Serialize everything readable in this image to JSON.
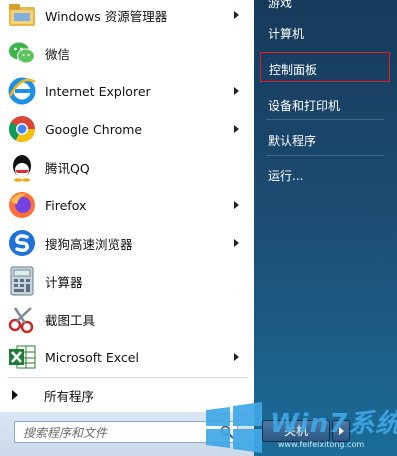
{
  "start_menu": {
    "programs": [
      {
        "label": "Windows 资源管理器",
        "icon": "folder-icon",
        "has_submenu": true
      },
      {
        "label": "微信",
        "icon": "wechat-icon",
        "has_submenu": false
      },
      {
        "label": "Internet Explorer",
        "icon": "internet-explorer-icon",
        "has_submenu": true
      },
      {
        "label": "Google Chrome",
        "icon": "chrome-icon",
        "has_submenu": true
      },
      {
        "label": "腾讯QQ",
        "icon": "qq-icon",
        "has_submenu": false
      },
      {
        "label": "Firefox",
        "icon": "firefox-icon",
        "has_submenu": true
      },
      {
        "label": "搜狗高速浏览器",
        "icon": "sogou-icon",
        "has_submenu": true
      },
      {
        "label": "计算器",
        "icon": "calculator-icon",
        "has_submenu": false
      },
      {
        "label": "截图工具",
        "icon": "snipping-tool-icon",
        "has_submenu": false
      },
      {
        "label": "Microsoft Excel",
        "icon": "excel-icon",
        "has_submenu": true
      }
    ],
    "all_programs_label": "所有程序",
    "search": {
      "placeholder": "搜索程序和文件"
    },
    "right_items": [
      {
        "label": "游戏"
      },
      {
        "label": "计算机"
      },
      {
        "label": "控制面板",
        "highlighted": true
      },
      {
        "label": "设备和打印机"
      },
      {
        "label": "默认程序"
      },
      {
        "label": "运行..."
      }
    ],
    "shutdown_label": "关机",
    "highlight_color": "#e21b22"
  },
  "watermark": {
    "title": "Win7系统",
    "url": "www.feifeixitong.com"
  }
}
